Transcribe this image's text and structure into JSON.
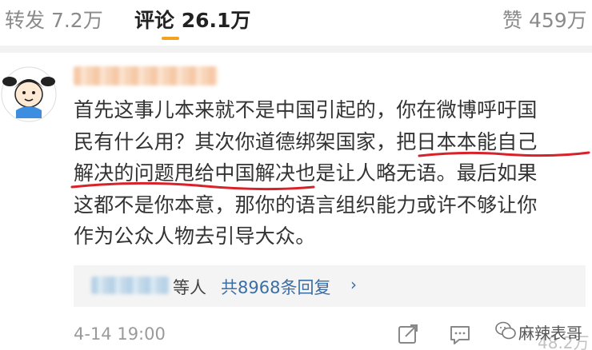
{
  "tabs": {
    "repost": "转发 7.2万",
    "comment": "评论 26.1万",
    "like": "赞 459万"
  },
  "comment": {
    "lines": [
      "首先这事儿本来就不是中国引起的，你在微博呼吁国",
      "民有什么用？其次你道德绑架国家，",
      "把日本本能自己",
      "解决的问题甩给中国解决",
      "也是让人略无语。最后如果",
      "这都不是你本意，那你的语言组织能力或许不够让你",
      "作为公众人物去引导大众。"
    ]
  },
  "replies": {
    "names_suffix": "等人",
    "count_text": "共8968条回复",
    "chevron": "›"
  },
  "footer": {
    "timestamp": "4-14 19:00",
    "watermark": "麻辣表哥",
    "likes": "48.2万"
  },
  "colors": {
    "accent": "#f4a020",
    "link": "#3a6ea5",
    "underline": "#d8222a"
  },
  "icons": [
    "avatar-cartoon",
    "share-icon",
    "reply-icon",
    "wechat-icon"
  ]
}
